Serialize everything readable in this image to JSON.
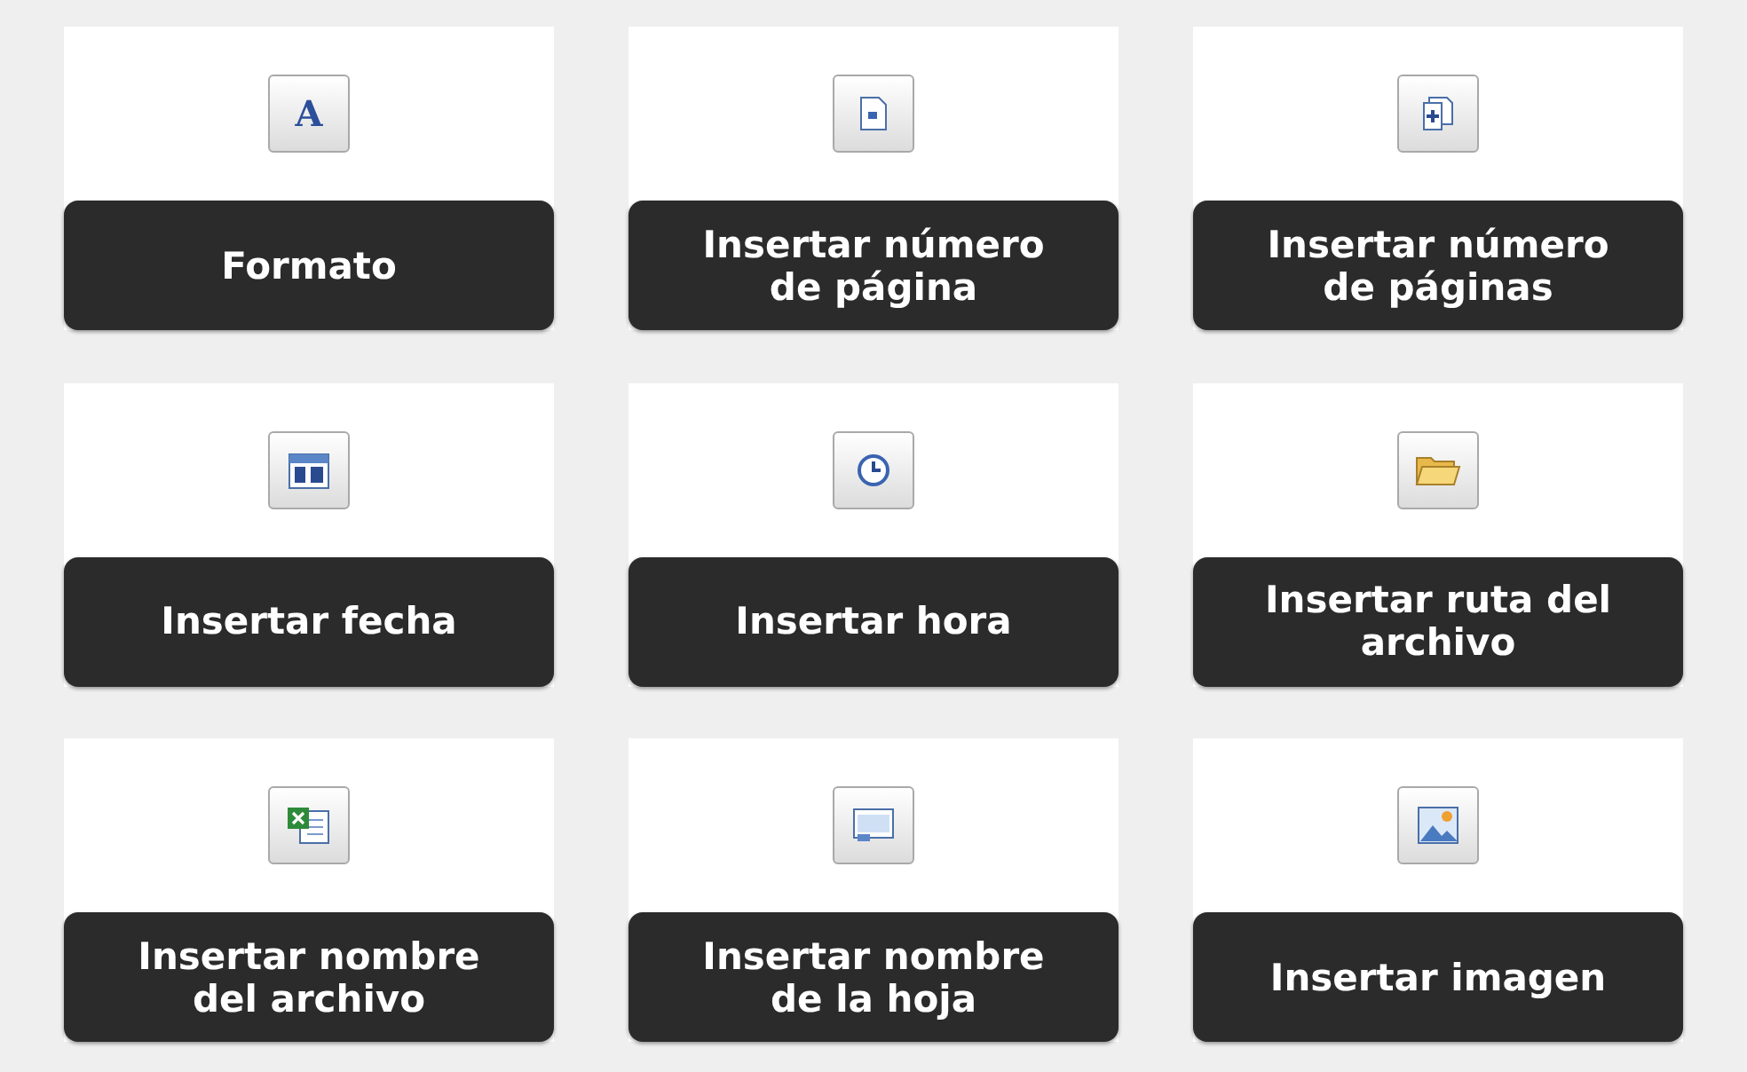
{
  "buttons": [
    {
      "kind": "format",
      "icon_text": "A",
      "label": [
        "Formato"
      ]
    },
    {
      "kind": "page-number",
      "label": [
        "Insertar número",
        "de página"
      ]
    },
    {
      "kind": "page-count",
      "label": [
        "Insertar número",
        "de páginas"
      ]
    },
    {
      "kind": "date",
      "label": [
        "Insertar fecha"
      ]
    },
    {
      "kind": "time",
      "label": [
        "Insertar hora"
      ]
    },
    {
      "kind": "path",
      "label": [
        "Insertar ruta del",
        "archivo"
      ]
    },
    {
      "kind": "filename",
      "label": [
        "Insertar nombre",
        "del archivo"
      ]
    },
    {
      "kind": "sheet",
      "label": [
        "Insertar nombre",
        "de la hoja"
      ]
    },
    {
      "kind": "image",
      "label": [
        "Insertar imagen"
      ]
    }
  ]
}
